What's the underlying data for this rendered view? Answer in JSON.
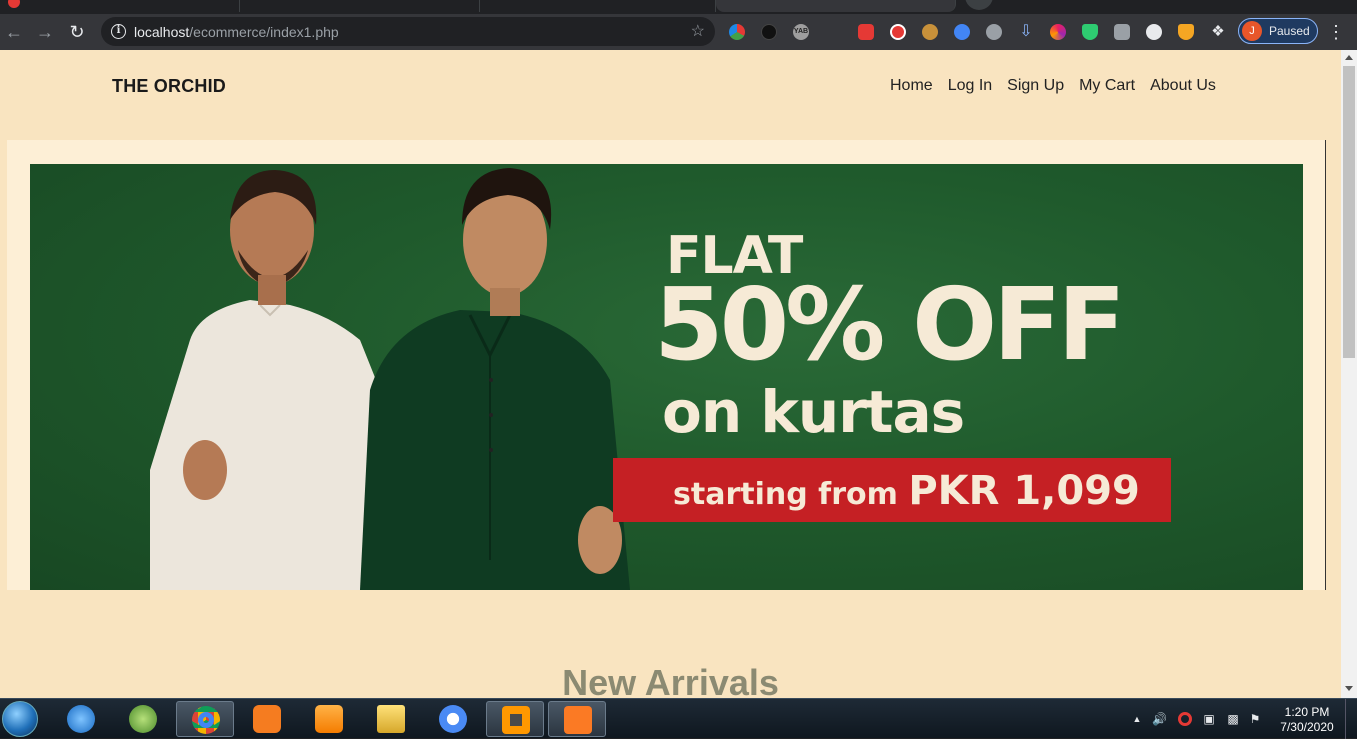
{
  "browser": {
    "url_host": "localhost",
    "url_path": "/ecommerce/index1.php",
    "profile_initial": "J",
    "profile_status": "Paused",
    "extensions": [
      "color-picker-icon",
      "dark-mode-icon",
      "yab-icon",
      "youtube-icon",
      "adblock-icon",
      "cookie-icon",
      "translator-icon",
      "settings-gear-icon",
      "download-icon",
      "night-icon",
      "shield-check-icon",
      "copy-icon",
      "gear-icon",
      "brave-lion-icon",
      "puzzle-icon"
    ]
  },
  "site": {
    "brand": "THE ORCHID",
    "nav": [
      "Home",
      "Log In",
      "Sign Up",
      "My Cart",
      "About Us"
    ]
  },
  "banner": {
    "line1": "FLAT",
    "line2": "50% OFF",
    "line3": "on kurtas",
    "promo_small": "starting from ",
    "promo_big": "PKR 1,099",
    "colors": {
      "background": "#1f5a2c",
      "promo_bar": "#c52024",
      "text": "#f6ead6"
    }
  },
  "section": {
    "title": "New Arrivals"
  },
  "taskbar": {
    "time": "1:20 PM",
    "date": "7/30/2020",
    "apps": [
      "internet-explorer-icon",
      "android-studio-icon",
      "chrome-icon",
      "uc-browser-icon",
      "media-player-icon",
      "file-explorer-icon",
      "chromium-icon",
      "sublime-text-icon",
      "xampp-icon"
    ]
  }
}
